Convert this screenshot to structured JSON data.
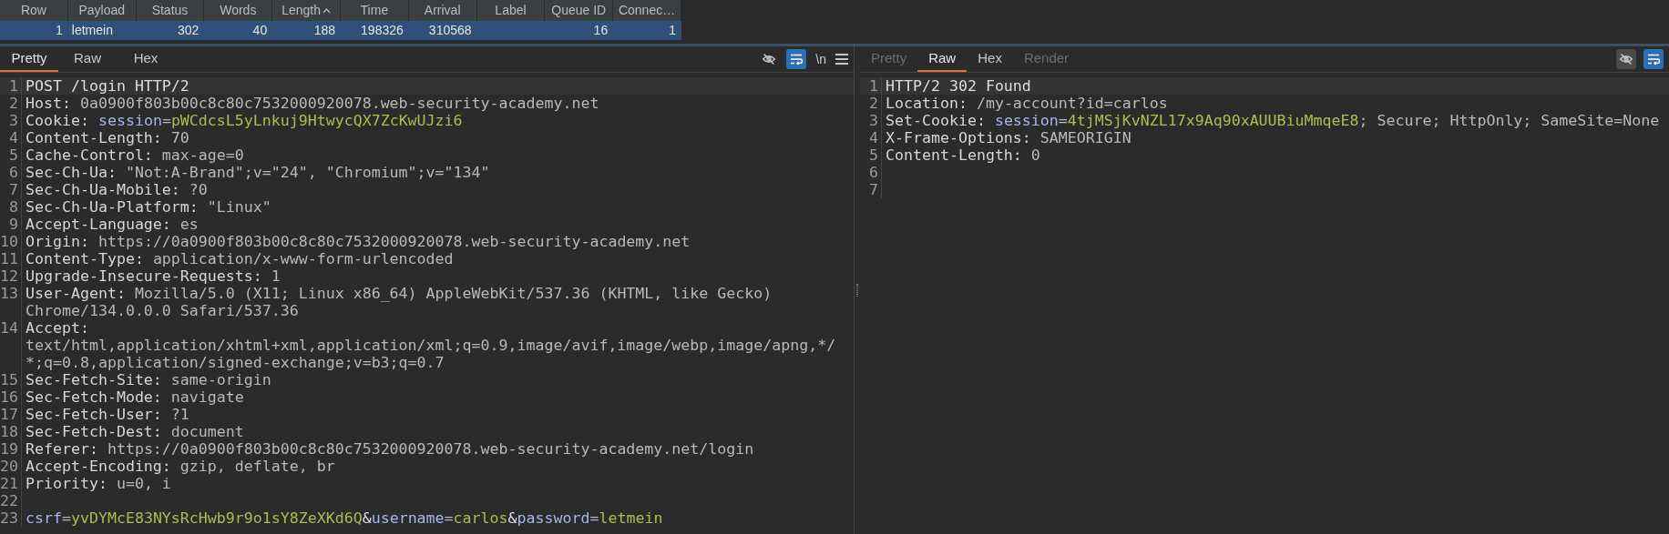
{
  "results_table": {
    "columns": [
      {
        "label": "Row",
        "sorted": false
      },
      {
        "label": "Payload",
        "sorted": false
      },
      {
        "label": "Status",
        "sorted": false
      },
      {
        "label": "Words",
        "sorted": false
      },
      {
        "label": "Length",
        "sorted": true
      },
      {
        "label": "Time",
        "sorted": false
      },
      {
        "label": "Arrival",
        "sorted": false
      },
      {
        "label": "Label",
        "sorted": false
      },
      {
        "label": "Queue ID",
        "sorted": false
      },
      {
        "label": "Connec…",
        "sorted": false
      }
    ],
    "rows": [
      {
        "selected": true,
        "cells": [
          "1",
          "letmein",
          "302",
          "40",
          "188",
          "198326",
          "310568",
          null,
          "16",
          "1"
        ]
      }
    ]
  },
  "request": {
    "tabs": [
      {
        "label": "Pretty",
        "selected": true,
        "disabled": false
      },
      {
        "label": "Raw",
        "selected": false,
        "disabled": false
      },
      {
        "label": "Hex",
        "selected": false,
        "disabled": false
      }
    ],
    "word_wrap_on": true,
    "newline_label": "\\n",
    "lines": [
      {
        "number": "1",
        "segments": [
          {
            "kind": "plain",
            "text": "POST /login HTTP/2"
          }
        ]
      },
      {
        "number": "2",
        "segments": [
          {
            "kind": "name",
            "text": "Host: "
          },
          {
            "kind": "value",
            "text": "0a0900f803b00c8c80c7532000920078.web-security-academy.net"
          }
        ]
      },
      {
        "number": "3",
        "segments": [
          {
            "kind": "name",
            "text": "Cookie: "
          },
          {
            "kind": "param",
            "text": "session"
          },
          {
            "kind": "value",
            "text": "="
          },
          {
            "kind": "token",
            "text": "pWCdcsL5yLnkuj9HtwycQX7ZcKwUJzi6"
          }
        ]
      },
      {
        "number": "4",
        "segments": [
          {
            "kind": "name",
            "text": "Content-Length: "
          },
          {
            "kind": "value",
            "text": "70"
          }
        ]
      },
      {
        "number": "5",
        "segments": [
          {
            "kind": "name",
            "text": "Cache-Control: "
          },
          {
            "kind": "value",
            "text": "max-age=0"
          }
        ]
      },
      {
        "number": "6",
        "segments": [
          {
            "kind": "name",
            "text": "Sec-Ch-Ua: "
          },
          {
            "kind": "value",
            "text": "\"Not:A-Brand\";v=\"24\", \"Chromium\";v=\"134\""
          }
        ]
      },
      {
        "number": "7",
        "segments": [
          {
            "kind": "name",
            "text": "Sec-Ch-Ua-Mobile: "
          },
          {
            "kind": "value",
            "text": "?0"
          }
        ]
      },
      {
        "number": "8",
        "segments": [
          {
            "kind": "name",
            "text": "Sec-Ch-Ua-Platform: "
          },
          {
            "kind": "value",
            "text": "\"Linux\""
          }
        ]
      },
      {
        "number": "9",
        "segments": [
          {
            "kind": "name",
            "text": "Accept-Language: "
          },
          {
            "kind": "value",
            "text": "es"
          }
        ]
      },
      {
        "number": "10",
        "segments": [
          {
            "kind": "name",
            "text": "Origin: "
          },
          {
            "kind": "value",
            "text": "https://0a0900f803b00c8c80c7532000920078.web-security-academy.net"
          }
        ]
      },
      {
        "number": "11",
        "segments": [
          {
            "kind": "name",
            "text": "Content-Type: "
          },
          {
            "kind": "value",
            "text": "application/x-www-form-urlencoded"
          }
        ]
      },
      {
        "number": "12",
        "segments": [
          {
            "kind": "name",
            "text": "Upgrade-Insecure-Requests: "
          },
          {
            "kind": "value",
            "text": "1"
          }
        ]
      },
      {
        "number": "13",
        "segments": [
          {
            "kind": "name",
            "text": "User-Agent: "
          },
          {
            "kind": "value",
            "text": "Mozilla/5.0 (X11; Linux x86_64) AppleWebKit/537.36 (KHTML, like Gecko) Chrome/134.0.0.0 Safari/537.36"
          }
        ]
      },
      {
        "number": "14",
        "segments": [
          {
            "kind": "name",
            "text": "Accept: "
          },
          {
            "kind": "value",
            "text": "text/html,application/xhtml+xml,application/xml;q=0.9,image/avif,image/webp,image/apng,*/*;q=0.8,application/signed-exchange;v=b3;q=0.7"
          }
        ]
      },
      {
        "number": "15",
        "segments": [
          {
            "kind": "name",
            "text": "Sec-Fetch-Site: "
          },
          {
            "kind": "value",
            "text": "same-origin"
          }
        ]
      },
      {
        "number": "16",
        "segments": [
          {
            "kind": "name",
            "text": "Sec-Fetch-Mode: "
          },
          {
            "kind": "value",
            "text": "navigate"
          }
        ]
      },
      {
        "number": "17",
        "segments": [
          {
            "kind": "name",
            "text": "Sec-Fetch-User: "
          },
          {
            "kind": "value",
            "text": "?1"
          }
        ]
      },
      {
        "number": "18",
        "segments": [
          {
            "kind": "name",
            "text": "Sec-Fetch-Dest: "
          },
          {
            "kind": "value",
            "text": "document"
          }
        ]
      },
      {
        "number": "19",
        "segments": [
          {
            "kind": "name",
            "text": "Referer: "
          },
          {
            "kind": "value",
            "text": "https://0a0900f803b00c8c80c7532000920078.web-security-academy.net/login"
          }
        ]
      },
      {
        "number": "20",
        "segments": [
          {
            "kind": "name",
            "text": "Accept-Encoding: "
          },
          {
            "kind": "value",
            "text": "gzip, deflate, br"
          }
        ]
      },
      {
        "number": "21",
        "segments": [
          {
            "kind": "name",
            "text": "Priority: "
          },
          {
            "kind": "value",
            "text": "u=0, i"
          }
        ]
      },
      {
        "number": "22"
      },
      {
        "number": "23",
        "segments": [
          {
            "kind": "param",
            "text": "csrf"
          },
          {
            "kind": "value",
            "text": "="
          },
          {
            "kind": "token",
            "text": "yvDYMcE83NYsRcHwb9r9o1sY8ZeXKd6Q"
          },
          {
            "kind": "plain",
            "text": "&"
          },
          {
            "kind": "param",
            "text": "username"
          },
          {
            "kind": "value",
            "text": "="
          },
          {
            "kind": "token",
            "text": "carlos"
          },
          {
            "kind": "plain",
            "text": "&"
          },
          {
            "kind": "param",
            "text": "password"
          },
          {
            "kind": "value",
            "text": "="
          },
          {
            "kind": "token",
            "text": "letmein"
          }
        ]
      }
    ]
  },
  "response": {
    "tabs": [
      {
        "label": "Pretty",
        "selected": false,
        "disabled": true
      },
      {
        "label": "Raw",
        "selected": true,
        "disabled": false
      },
      {
        "label": "Hex",
        "selected": false,
        "disabled": false
      },
      {
        "label": "Render",
        "selected": false,
        "disabled": true
      }
    ],
    "word_wrap_on": true,
    "lines": [
      {
        "number": "1",
        "segments": [
          {
            "kind": "plain",
            "text": "HTTP/2 302 Found"
          }
        ]
      },
      {
        "number": "2",
        "segments": [
          {
            "kind": "name",
            "text": "Location: "
          },
          {
            "kind": "value",
            "text": "/my-account?id=carlos"
          }
        ]
      },
      {
        "number": "3",
        "segments": [
          {
            "kind": "name",
            "text": "Set-Cookie: "
          },
          {
            "kind": "param",
            "text": "session"
          },
          {
            "kind": "value",
            "text": "="
          },
          {
            "kind": "token",
            "text": "4tjMSjKvNZL17x9Aq90xAUUBiuMmqeE8"
          },
          {
            "kind": "value",
            "text": "; Secure; HttpOnly; SameSite=None"
          }
        ]
      },
      {
        "number": "4",
        "segments": [
          {
            "kind": "name",
            "text": "X-Frame-Options: "
          },
          {
            "kind": "value",
            "text": "SAMEORIGIN"
          }
        ]
      },
      {
        "number": "5",
        "segments": [
          {
            "kind": "name",
            "text": "Content-Length: "
          },
          {
            "kind": "value",
            "text": "0"
          }
        ]
      },
      {
        "number": "6"
      },
      {
        "number": "7"
      }
    ]
  }
}
